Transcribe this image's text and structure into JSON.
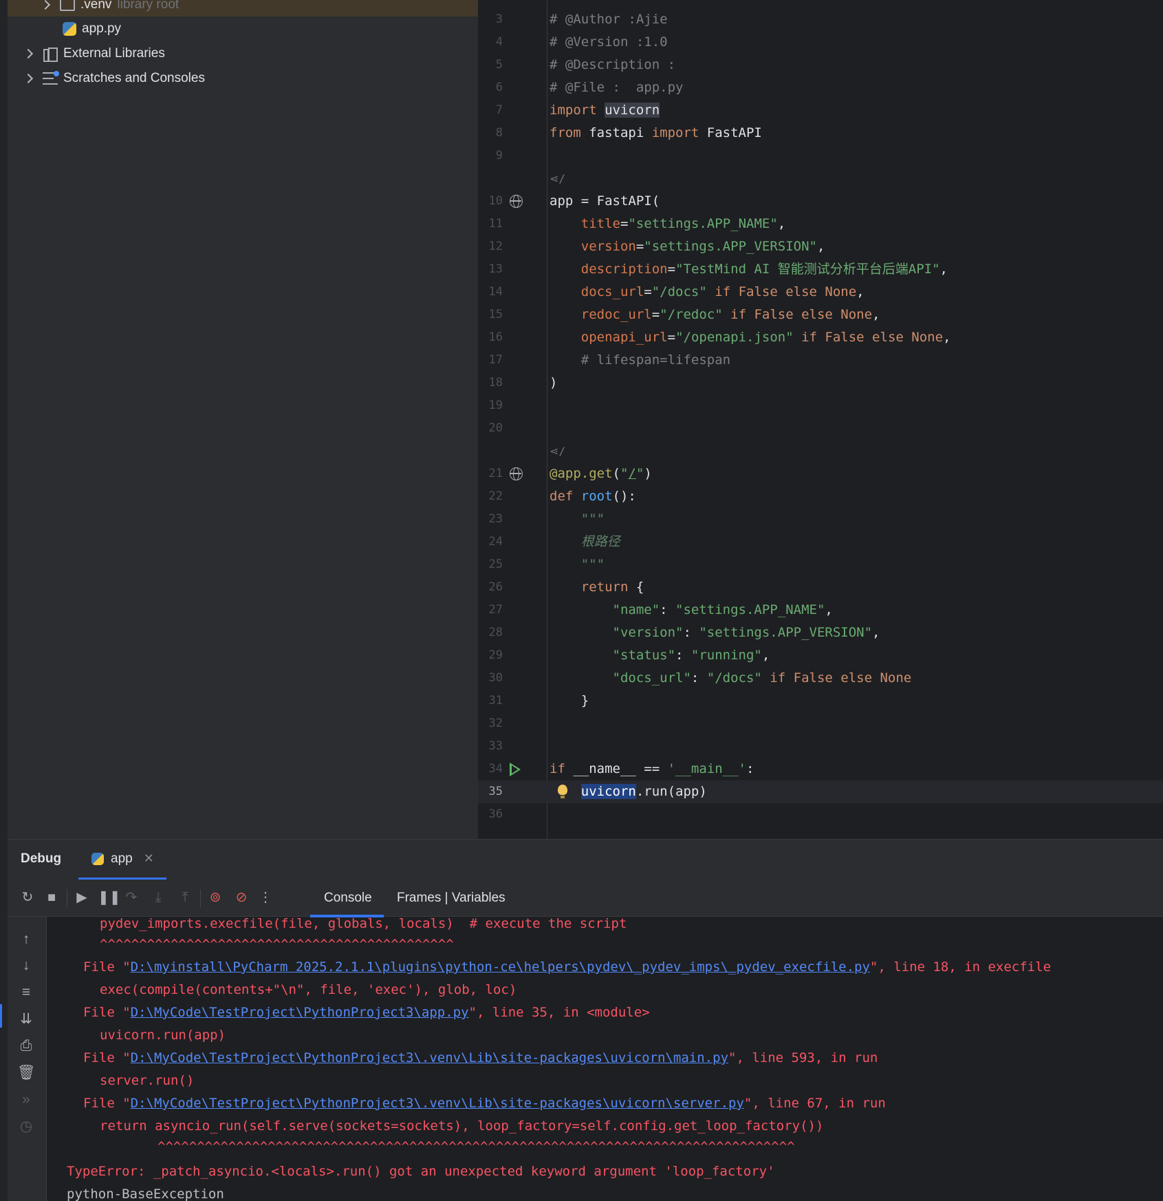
{
  "project_tree": {
    "items": [
      {
        "label": ".venv",
        "suffix": "library root",
        "icon": "folder-icon"
      },
      {
        "label": "app.py",
        "icon": "python-file-icon"
      },
      {
        "label": "External Libraries",
        "icon": "library-icon"
      },
      {
        "label": "Scratches and Consoles",
        "icon": "scratches-icon"
      }
    ]
  },
  "editor": {
    "lines": [
      {
        "n": "3",
        "text": "# @Author :Ajie"
      },
      {
        "n": "4",
        "text": "# @Version :1.0"
      },
      {
        "n": "5",
        "text": "# @Description :"
      },
      {
        "n": "6",
        "text": "# @File :  app.py"
      },
      {
        "n": "7",
        "text": "import uvicorn"
      },
      {
        "n": "8",
        "text": "from fastapi import FastAPI"
      },
      {
        "n": "9",
        "text": ""
      },
      {
        "n": "10",
        "text": "app = FastAPI("
      },
      {
        "n": "11",
        "text": "title=\"settings.APP_NAME\","
      },
      {
        "n": "12",
        "text": "version=\"settings.APP_VERSION\","
      },
      {
        "n": "13",
        "text": "description=\"TestMind AI 智能测试分析平台后端API\","
      },
      {
        "n": "14",
        "text": "docs_url=\"/docs\" if False else None,"
      },
      {
        "n": "15",
        "text": "redoc_url=\"/redoc\" if False else None,"
      },
      {
        "n": "16",
        "text": "openapi_url=\"/openapi.json\" if False else None,"
      },
      {
        "n": "17",
        "text": "# lifespan=lifespan"
      },
      {
        "n": "18",
        "text": ")"
      },
      {
        "n": "19",
        "text": ""
      },
      {
        "n": "20",
        "text": ""
      },
      {
        "n": "21",
        "text": "@app.get(\"/\")"
      },
      {
        "n": "22",
        "text": "def root():"
      },
      {
        "n": "23",
        "text": "\"\"\""
      },
      {
        "n": "24",
        "text": "根路径"
      },
      {
        "n": "25",
        "text": "\"\"\""
      },
      {
        "n": "26",
        "text": "return {"
      },
      {
        "n": "27",
        "text": "\"name\": \"settings.APP_NAME\","
      },
      {
        "n": "28",
        "text": "\"version\": \"settings.APP_VERSION\","
      },
      {
        "n": "29",
        "text": "\"status\": \"running\","
      },
      {
        "n": "30",
        "text": "\"docs_url\": \"/docs\" if False else None"
      },
      {
        "n": "31",
        "text": "}"
      },
      {
        "n": "32",
        "text": ""
      },
      {
        "n": "33",
        "text": ""
      },
      {
        "n": "34",
        "text": "if __name__ == '__main__':"
      },
      {
        "n": "35",
        "text": "uvicorn.run(app)"
      },
      {
        "n": "36",
        "text": ""
      }
    ],
    "share_marker": "/"
  },
  "debug": {
    "title": "Debug",
    "tab_label": "app",
    "subtabs": {
      "console": "Console",
      "frames": "Frames | Variables"
    },
    "console_lines": {
      "l1": "pydev_imports.execfile(file, globals, locals)  # execute the script",
      "l2": "^^^^^^^^^^^^^^^^^^^^^^^^^^^^^^^^^^^^^^^^^^^^^",
      "l3_pre": "File \"",
      "l3_link": "D:\\myinstall\\PyCharm 2025.2.1.1\\plugins\\python-ce\\helpers\\pydev\\_pydev_imps\\_pydev_execfile.py",
      "l3_post": "\", line 18, in execfile",
      "l4": "exec(compile(contents+\"\\n\", file, 'exec'), glob, loc)",
      "l5_pre": "File \"",
      "l5_link": "D:\\MyCode\\TestProject\\PythonProject3\\app.py",
      "l5_post": "\", line 35, in <module>",
      "l6": "uvicorn.run(app)",
      "l7_pre": "File \"",
      "l7_link": "D:\\MyCode\\TestProject\\PythonProject3\\.venv\\Lib\\site-packages\\uvicorn\\main.py",
      "l7_post": "\", line 593, in run",
      "l8": "server.run()",
      "l9_pre": "File \"",
      "l9_link": "D:\\MyCode\\TestProject\\PythonProject3\\.venv\\Lib\\site-packages\\uvicorn\\server.py",
      "l9_post": "\", line 67, in run",
      "l10": "return asyncio_run(self.serve(sockets=sockets), loop_factory=self.config.get_loop_factory())",
      "l11": "^^^^^^^^^^^^^^^^^^^^^^^^^^^^^^^^^^^^^^^^^^^^^^^^^^^^^^^^^^^^^^^^^^^^^^^^^^^^^^^^^",
      "l12": "TypeError: _patch_asyncio.<locals>.run() got an unexpected keyword argument 'loop_factory'",
      "l13": "python-BaseException"
    }
  },
  "colors": {
    "background": "#1e1f22",
    "panel": "#2b2d30",
    "keyword": "#cf8e6d",
    "string": "#6aab73",
    "error": "#f75464",
    "link": "#548af7",
    "accent": "#3574f0"
  }
}
